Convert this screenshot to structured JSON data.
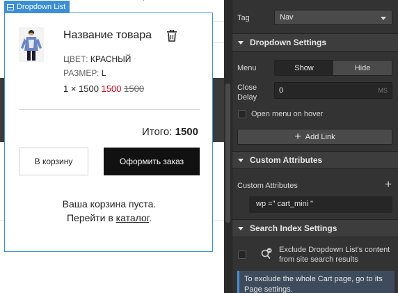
{
  "canvas": {
    "element_tag": "Dropdown List",
    "top_glyph": "’"
  },
  "cart": {
    "product_name": "Название товара",
    "color_label": "ЦВЕТ:",
    "color_value": "КРАСНЫЙ",
    "size_label": "РАЗМЕР:",
    "size_value": "L",
    "qty_price": "1 × 1500",
    "sale_price": "1500",
    "old_price": "1500",
    "total_label": "Итого:",
    "total_value": "1500",
    "btn_cart": "В корзину",
    "btn_checkout": "Оформить заказ",
    "empty_line1": "Ваша корзина пуста.",
    "empty_line2_prefix": "Перейти в",
    "empty_link": "каталог",
    "empty_line2_suffix": "."
  },
  "panel": {
    "tag_label": "Tag",
    "tag_value": "Nav",
    "dropdown_settings_title": "Dropdown Settings",
    "menu_label": "Menu",
    "menu_show": "Show",
    "menu_hide": "Hide",
    "close_delay_label": "Close Delay",
    "close_delay_value": "0",
    "close_delay_unit": "MS",
    "open_on_hover_label": "Open menu on hover",
    "add_link_label": "Add Link",
    "custom_attributes_title": "Custom Attributes",
    "custom_attributes_label": "Custom Attributes",
    "attribute_value": "wp =\" cart_mini \"",
    "search_index_title": "Search Index Settings",
    "exclude_text": "Exclude Dropdown List's content from site search results",
    "info_text": "To exclude the whole Cart page, go to its Page settings."
  },
  "colors": {
    "accent": "#3b8fd6",
    "sale": "#d0021b",
    "checkout_bg": "#111111",
    "panel_bg": "#333333"
  }
}
